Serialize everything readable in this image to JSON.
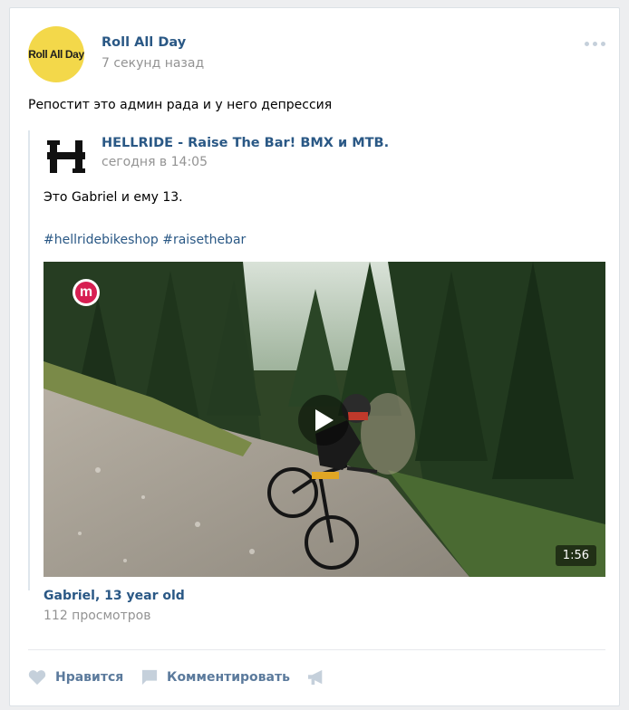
{
  "post": {
    "author": "Roll All Day",
    "avatar_text": "Roll All Day",
    "time": "7 секунд назад",
    "text": "Репостит это админ рада и у него депрессия"
  },
  "repost": {
    "author": "HELLRIDE - Raise The Bar! BMX и MTB.",
    "time": "сегодня в 14:05",
    "text": "Это Gabriel и ему 13.",
    "hashtags": [
      "#hellridebikeshop",
      "#raisethebar"
    ]
  },
  "video": {
    "channel_badge": "m",
    "duration": "1:56",
    "title": "Gabriel, 13 year old",
    "views": "112 просмотров"
  },
  "actions": {
    "like_label": "Нравится",
    "comment_label": "Комментировать"
  },
  "colors": {
    "link": "#2a5885",
    "meta": "#939393",
    "action": "#5b7a9c",
    "avatar_bg": "#f3d84a",
    "badge": "#d71f52"
  }
}
